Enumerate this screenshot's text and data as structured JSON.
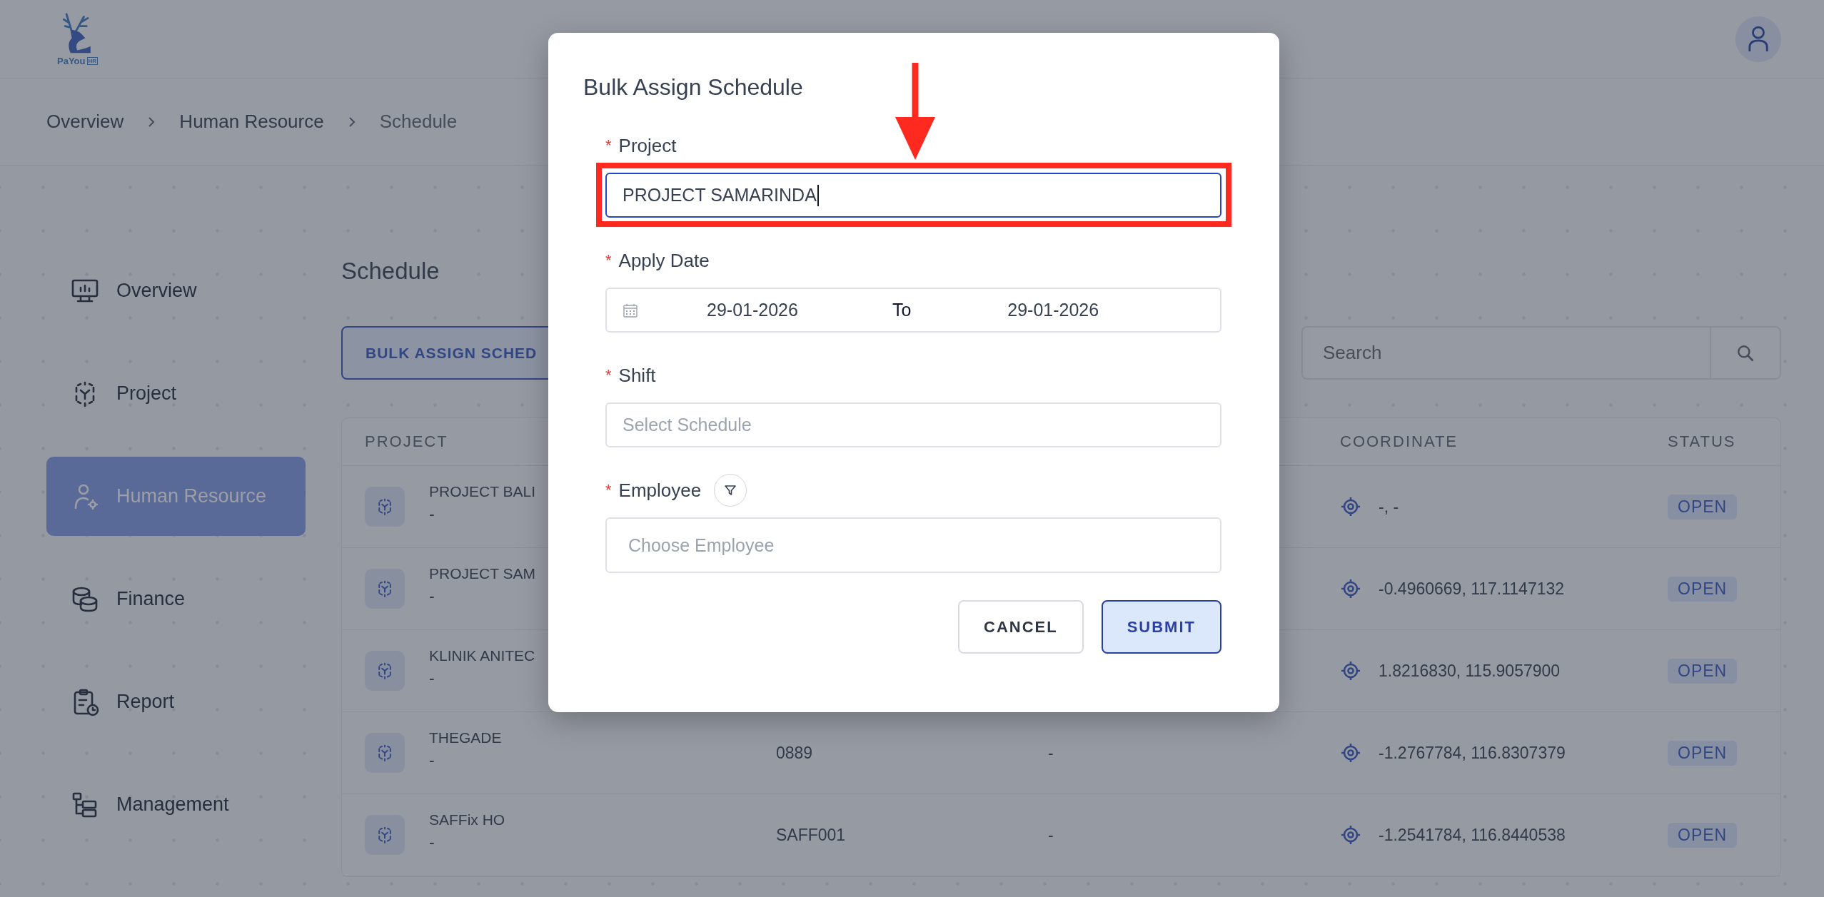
{
  "header": {
    "logo_text": "PaYou",
    "logo_badge": "HR"
  },
  "breadcrumb": [
    "Overview",
    "Human Resource",
    "Schedule"
  ],
  "sidebar": {
    "items": [
      {
        "label": "Overview",
        "selected": false
      },
      {
        "label": "Project",
        "selected": false
      },
      {
        "label": "Human Resource",
        "selected": true
      },
      {
        "label": "Finance",
        "selected": false
      },
      {
        "label": "Report",
        "selected": false
      },
      {
        "label": "Management",
        "selected": false
      }
    ]
  },
  "page": {
    "title": "Schedule",
    "bulk_button": "BULK ASSIGN SCHED",
    "search": {
      "placeholder": "Search"
    }
  },
  "table": {
    "columns": [
      "PROJECT",
      "COORDINATE",
      "STATUS"
    ],
    "rows": [
      {
        "project": "PROJECT BALI",
        "subtitle": "-",
        "coordinate": "-, -",
        "status": "OPEN"
      },
      {
        "project": "PROJECT SAM",
        "subtitle": "-",
        "coordinate": "-0.4960669, 117.1147132",
        "status": "OPEN"
      },
      {
        "project": "KLINIK ANITEC",
        "subtitle": "-",
        "coordinate": "1.8216830, 115.9057900",
        "status": "OPEN"
      },
      {
        "project": "THEGADE",
        "subtitle": "-",
        "column_2": "0889",
        "column_3": "-",
        "coordinate": "-1.2767784, 116.8307379",
        "status": "OPEN"
      },
      {
        "project": "SAFFix HO",
        "subtitle": "-",
        "column_2": "SAFF001",
        "column_3": "-",
        "coordinate": "-1.2541784, 116.8440538",
        "status": "OPEN"
      }
    ]
  },
  "dialog": {
    "title": "Bulk Assign Schedule",
    "fields": [
      {
        "kind": "text",
        "required_mark": "*",
        "label": "Project",
        "value": "PROJECT SAMARINDA",
        "focused": true
      },
      {
        "kind": "date_range",
        "required_mark": "*",
        "label": "Apply Date",
        "from": "29-01-2026",
        "separator": "To",
        "to": "29-01-2026",
        "focused": false
      },
      {
        "kind": "select",
        "required_mark": "*",
        "label": "Shift",
        "placeholder": "Select Schedule",
        "focused": false
      },
      {
        "kind": "select",
        "required_mark": "*",
        "label": "Employee",
        "placeholder": "Choose Employee",
        "focused": false,
        "filter_button": true
      }
    ],
    "buttons": [
      {
        "label": "CANCEL",
        "primary": false
      },
      {
        "label": "SUBMIT",
        "primary": true
      }
    ]
  }
}
